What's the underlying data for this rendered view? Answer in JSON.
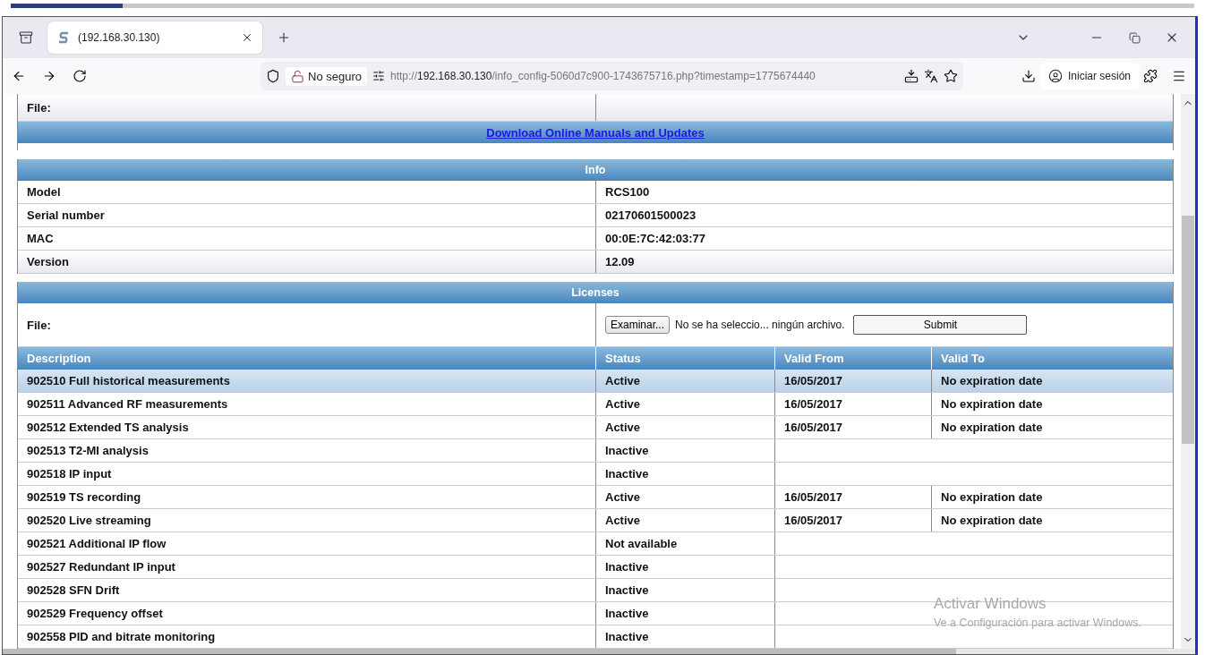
{
  "browser": {
    "tab_title": "(192.168.30.130)",
    "security": "No seguro",
    "url_prefix": "http://",
    "url_host": "192.168.30.130",
    "url_rest": "/info_config-5060d7c900-1743675716.php?timestamp=1775674440",
    "sign_in": "Iniciar sesión"
  },
  "top_file": {
    "label": "File:"
  },
  "download_link": "Download Online Manuals and Updates",
  "info": {
    "title": "Info",
    "rows": [
      {
        "label": "Model",
        "value": "RCS100"
      },
      {
        "label": "Serial number",
        "value": "02170601500023"
      },
      {
        "label": "MAC",
        "value": "00:0E:7C:42:03:77"
      },
      {
        "label": "Version",
        "value": "12.09"
      }
    ]
  },
  "licenses": {
    "title": "Licenses",
    "file_label": "File:",
    "browse_button": "Examinar...",
    "file_status": "No se ha seleccio... ningún archivo.",
    "submit_button": "Submit",
    "columns": [
      "Description",
      "Status",
      "Valid From",
      "Valid To"
    ],
    "rows": [
      {
        "description": "902510 Full historical measurements",
        "status": "Active",
        "valid_from": "16/05/2017",
        "valid_to": "No expiration date",
        "selected": true
      },
      {
        "description": "902511 Advanced RF measurements",
        "status": "Active",
        "valid_from": "16/05/2017",
        "valid_to": "No expiration date",
        "selected": false
      },
      {
        "description": "902512 Extended TS analysis",
        "status": "Active",
        "valid_from": "16/05/2017",
        "valid_to": "No expiration date",
        "selected": false
      },
      {
        "description": "902513 T2-MI analysis",
        "status": "Inactive",
        "selected": false
      },
      {
        "description": "902518 IP input",
        "status": "Inactive",
        "selected": false
      },
      {
        "description": "902519 TS recording",
        "status": "Active",
        "valid_from": "16/05/2017",
        "valid_to": "No expiration date",
        "selected": false
      },
      {
        "description": "902520 Live streaming",
        "status": "Active",
        "valid_from": "16/05/2017",
        "valid_to": "No expiration date",
        "selected": false
      },
      {
        "description": "902521 Additional IP flow",
        "status": "Not available",
        "selected": false
      },
      {
        "description": "902527 Redundant IP input",
        "status": "Inactive",
        "selected": false
      },
      {
        "description": "902528 SFN Drift",
        "status": "Inactive",
        "selected": false
      },
      {
        "description": "902529 Frequency offset",
        "status": "Inactive",
        "selected": false
      },
      {
        "description": "902558 PID and bitrate monitoring",
        "status": "Inactive",
        "selected": false
      }
    ]
  },
  "os_notice": {
    "title": "Activar Windows",
    "subtitle": "Ve a Configuración para activar Windows."
  }
}
